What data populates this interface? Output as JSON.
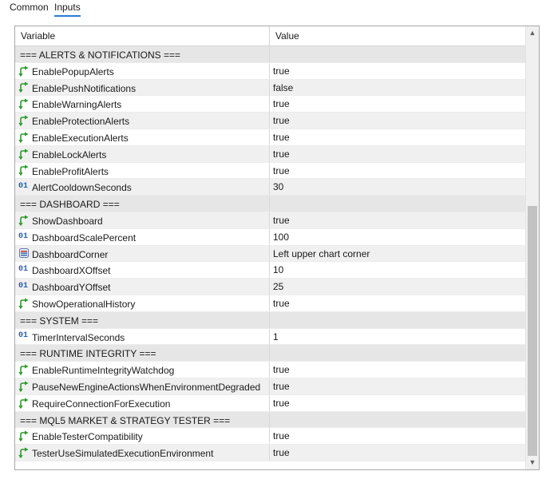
{
  "tabs": [
    {
      "label": "Common",
      "active": false
    },
    {
      "label": "Inputs",
      "active": true
    }
  ],
  "accent_color": "#2b7bd6",
  "table": {
    "columns": {
      "variable": "Variable",
      "value": "Value"
    },
    "rows": [
      {
        "type": "group",
        "label": "=== ALERTS & NOTIFICATIONS ===",
        "value": ""
      },
      {
        "type": "bool",
        "icon": "green-arrow-icon",
        "label": "EnablePopupAlerts",
        "value": "true"
      },
      {
        "type": "bool",
        "icon": "green-arrow-icon",
        "label": "EnablePushNotifications",
        "value": "false"
      },
      {
        "type": "bool",
        "icon": "green-arrow-icon",
        "label": "EnableWarningAlerts",
        "value": "true"
      },
      {
        "type": "bool",
        "icon": "green-arrow-icon",
        "label": "EnableProtectionAlerts",
        "value": "true"
      },
      {
        "type": "bool",
        "icon": "green-arrow-icon",
        "label": "EnableExecutionAlerts",
        "value": "true"
      },
      {
        "type": "bool",
        "icon": "green-arrow-icon",
        "label": "EnableLockAlerts",
        "value": "true"
      },
      {
        "type": "bool",
        "icon": "green-arrow-icon",
        "label": "EnableProfitAlerts",
        "value": "true"
      },
      {
        "type": "int",
        "icon": "integer-01-icon",
        "icon_text": "01",
        "label": "AlertCooldownSeconds",
        "value": "30"
      },
      {
        "type": "group",
        "label": "=== DASHBOARD ===",
        "value": ""
      },
      {
        "type": "bool",
        "icon": "green-arrow-icon",
        "label": "ShowDashboard",
        "value": "true"
      },
      {
        "type": "int",
        "icon": "integer-01-icon",
        "icon_text": "01",
        "label": "DashboardScalePercent",
        "value": "100"
      },
      {
        "type": "enum",
        "icon": "enum-list-icon",
        "label": "DashboardCorner",
        "value": "Left upper chart corner"
      },
      {
        "type": "int",
        "icon": "integer-01-icon",
        "icon_text": "01",
        "label": "DashboardXOffset",
        "value": "10"
      },
      {
        "type": "int",
        "icon": "integer-01-icon",
        "icon_text": "01",
        "label": "DashboardYOffset",
        "value": "25"
      },
      {
        "type": "bool",
        "icon": "green-arrow-icon",
        "label": "ShowOperationalHistory",
        "value": "true"
      },
      {
        "type": "group",
        "label": "=== SYSTEM ===",
        "value": ""
      },
      {
        "type": "int",
        "icon": "integer-01-icon",
        "icon_text": "01",
        "label": "TimerIntervalSeconds",
        "value": "1"
      },
      {
        "type": "group",
        "label": "=== RUNTIME INTEGRITY ===",
        "value": ""
      },
      {
        "type": "bool",
        "icon": "green-arrow-icon",
        "label": "EnableRuntimeIntegrityWatchdog",
        "value": "true"
      },
      {
        "type": "bool",
        "icon": "green-arrow-icon",
        "label": "PauseNewEngineActionsWhenEnvironmentDegraded",
        "value": "true"
      },
      {
        "type": "bool",
        "icon": "green-arrow-icon",
        "label": "RequireConnectionForExecution",
        "value": "true"
      },
      {
        "type": "group",
        "label": "=== MQL5 MARKET & STRATEGY TESTER ===",
        "value": ""
      },
      {
        "type": "bool",
        "icon": "green-arrow-icon",
        "label": "EnableTesterCompatibility",
        "value": "true"
      },
      {
        "type": "bool",
        "icon": "green-arrow-icon",
        "label": "TesterUseSimulatedExecutionEnvironment",
        "value": "true"
      }
    ]
  },
  "scrollbar": {
    "up_icon": "scroll-up-arrow-icon",
    "down_icon": "scroll-down-arrow-icon",
    "position_fraction": 0.4,
    "visible_fraction": 0.6
  }
}
